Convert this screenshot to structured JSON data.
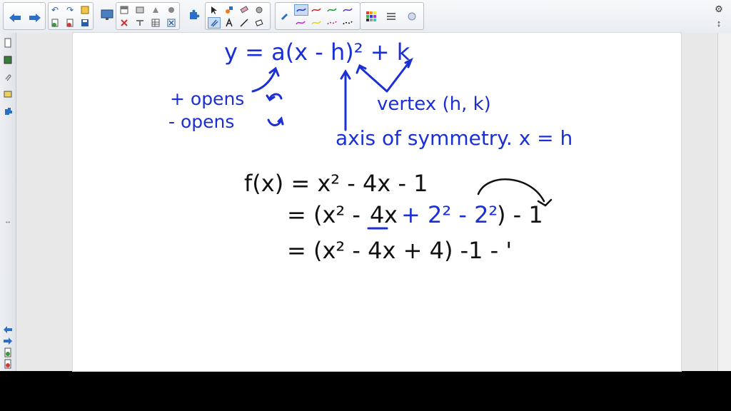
{
  "toolbar": {
    "buttons": [
      "back-icon",
      "forward-icon",
      "undo-icon",
      "redo-icon",
      "new-page-icon",
      "save-icon",
      "delete-icon",
      "screen-shade-icon",
      "table-icon",
      "close-view-icon",
      "display-icon",
      "capture-icon",
      "insert-icon",
      "properties-icon",
      "select-icon",
      "fill-icon",
      "eraser-icon",
      "magic-pen-icon",
      "pen-icon",
      "shapes-icon",
      "line-icon",
      "text-icon",
      "color-palette-icon",
      "line-style-icon",
      "fill-effect-icon"
    ],
    "right_controls": [
      "gear-icon",
      "updown-icon"
    ]
  },
  "colors": {
    "blue_ink": "#1a2fd6",
    "black_ink": "#111111"
  },
  "notes": {
    "eq_vertex_form": "y = a(x - h)² + k",
    "positive_opens": "+ opens",
    "negative_opens": "- opens",
    "vertex_label": "vertex (h, k)",
    "axis_label": "axis of symmetry. x = h",
    "line1": "f(x) = x² - 4x - 1",
    "line2_black_start": "= (x² -",
    "line2_four": "4",
    "line2_black_x": "x",
    "line2_blue": "+ 2² - 2²",
    "line2_end": ") - 1",
    "line3": "= (x² - 4x + 4) -1 - '"
  }
}
